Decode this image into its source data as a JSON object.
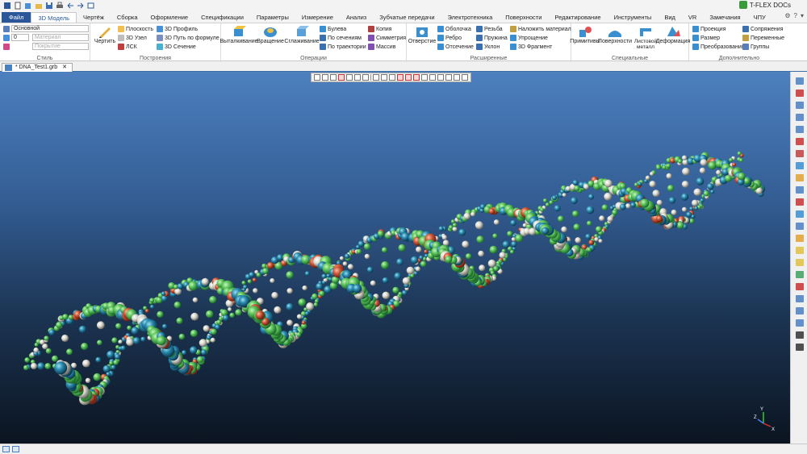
{
  "app": {
    "brand": "T-FLEX DOCs"
  },
  "tabs": [
    {
      "label": "Файл"
    },
    {
      "label": "3D Модель"
    },
    {
      "label": "Чертёж"
    },
    {
      "label": "Сборка"
    },
    {
      "label": "Оформление"
    },
    {
      "label": "Спецификации"
    },
    {
      "label": "Параметры"
    },
    {
      "label": "Измерение"
    },
    {
      "label": "Анализ"
    },
    {
      "label": "Зубчатые передачи"
    },
    {
      "label": "Электротехника"
    },
    {
      "label": "Поверхности"
    },
    {
      "label": "Редактирование"
    },
    {
      "label": "Инструменты"
    },
    {
      "label": "Вид"
    },
    {
      "label": "VR"
    },
    {
      "label": "Замечания"
    },
    {
      "label": "ЧПУ"
    }
  ],
  "ribbon": {
    "style": {
      "title": "Стиль",
      "layer": "Основной",
      "number": "0",
      "material": "Материал",
      "coating": "Покрытие"
    },
    "build": {
      "title": "Построения",
      "draw": "Чертить",
      "plane": "Плоскость",
      "node3d": "3D Узел",
      "lcs": "ЛСК",
      "profile3d": "3D Профиль",
      "path_formula": "3D Путь по формуле",
      "section3d": "3D Сечение"
    },
    "ops": {
      "title": "Операции",
      "extrude": "Выталкивание",
      "rotate": "Вращение",
      "smooth": "Сглаживание",
      "boolean": "Булева",
      "by_sections": "По сечениям",
      "by_path": "По траектории",
      "copy": "Копия",
      "symmetry": "Симметрия",
      "array": "Массив"
    },
    "ext": {
      "title": "Расширенные",
      "hole": "Отверстие",
      "shell": "Оболочка",
      "rib": "Ребро",
      "cut": "Отсечение",
      "thread": "Резьба",
      "spring": "Пружина",
      "draft": "Уклон",
      "apply_material": "Наложить материал",
      "simplify": "Упрощение",
      "fragment3d": "3D Фрагмент"
    },
    "special": {
      "title": "Специальные",
      "primitives": "Примитивы",
      "surfaces": "Поверхности",
      "sheet_metal": "Листовой металл",
      "deform": "Деформация"
    },
    "extra": {
      "title": "Дополнительно",
      "projection": "Проекция",
      "size": "Размер",
      "transform": "Преобразования",
      "mates": "Сопряжения",
      "variables": "Переменные",
      "groups": "Группы"
    }
  },
  "document": {
    "tab_label": "* DNA_Test1.grb"
  },
  "axes": {
    "x": "X",
    "y": "Y",
    "z": "Z"
  },
  "colors": {
    "accent": "#2b579a",
    "file_tab": "#2b579a",
    "viewport_top": "#4d80bf",
    "viewport_bottom": "#0b1420",
    "atom_green": "#5cc45c",
    "atom_teal": "#2a8ab0",
    "atom_red": "#d0583a",
    "atom_white": "#d8d6cc"
  }
}
